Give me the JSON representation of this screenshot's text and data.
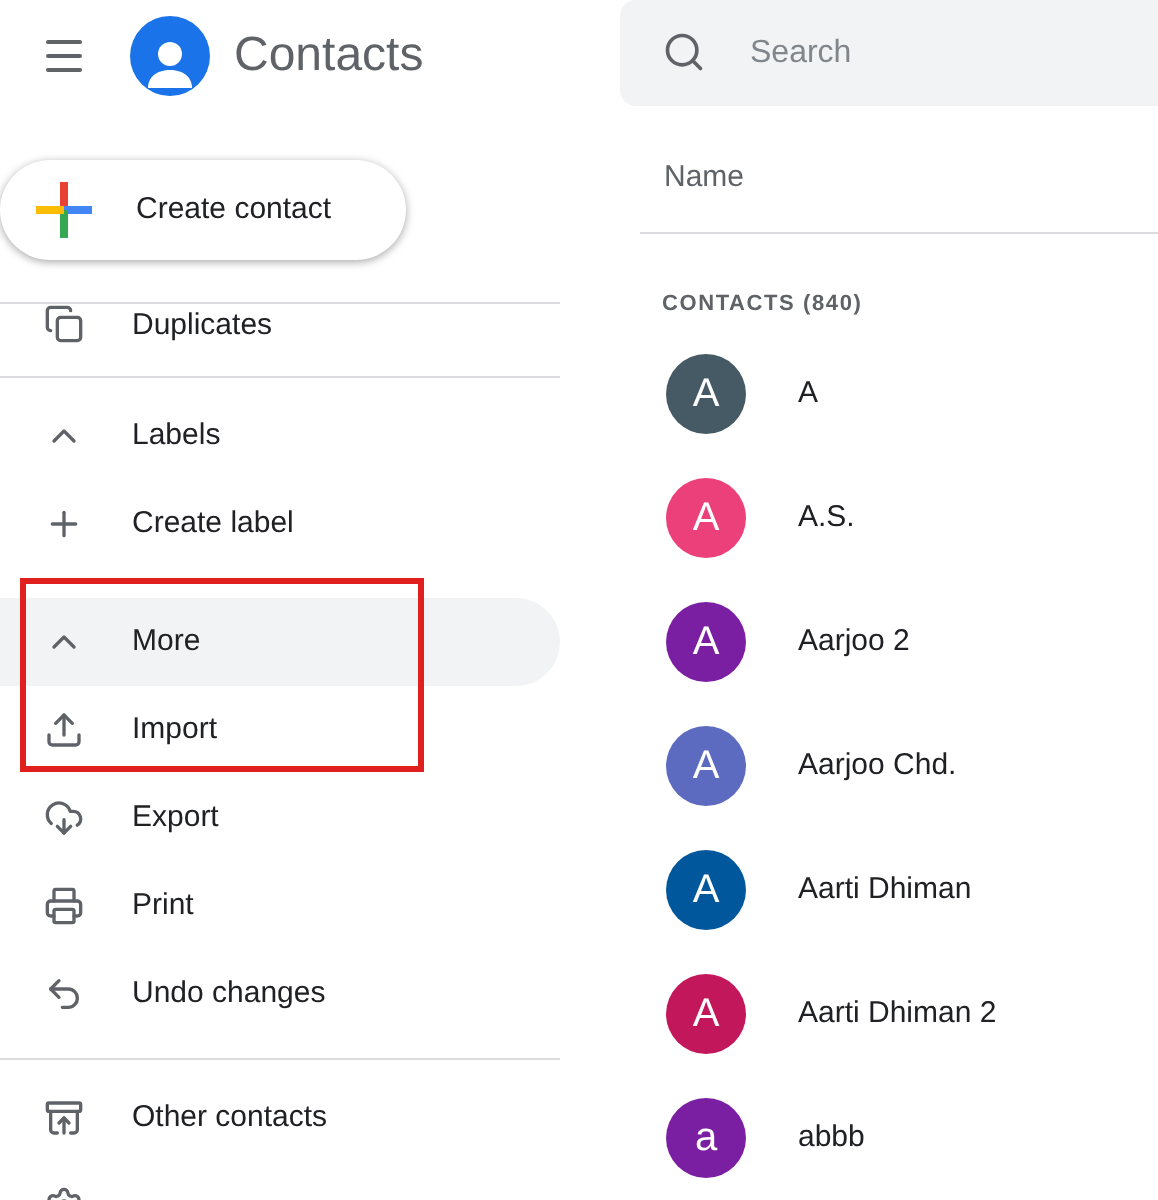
{
  "app": {
    "title": "Contacts"
  },
  "create_button": {
    "label": "Create contact"
  },
  "sidebar": {
    "items": [
      {
        "kind": "item",
        "label": "Duplicates",
        "selected": false
      },
      {
        "kind": "divider"
      },
      {
        "kind": "item",
        "label": "Labels",
        "selected": false
      },
      {
        "kind": "item",
        "label": "Create label",
        "selected": false
      },
      {
        "kind": "gap"
      },
      {
        "kind": "item",
        "label": "More",
        "selected": true
      },
      {
        "kind": "item",
        "label": "Import",
        "selected": false
      },
      {
        "kind": "item",
        "label": "Export",
        "selected": false
      },
      {
        "kind": "item",
        "label": "Print",
        "selected": false
      },
      {
        "kind": "item",
        "label": "Undo changes",
        "selected": false
      },
      {
        "kind": "divider"
      },
      {
        "kind": "item",
        "label": "Other contacts",
        "selected": false
      },
      {
        "kind": "cut",
        "selected": false
      }
    ]
  },
  "highlight": {
    "color": "#e0201f"
  },
  "search": {
    "placeholder": "Search"
  },
  "table": {
    "columns": [
      "Name"
    ]
  },
  "contacts": {
    "heading": "CONTACTS (840)",
    "rows": [
      {
        "initial": "A",
        "name": "A",
        "color": "#455a64"
      },
      {
        "initial": "A",
        "name": "A.S.",
        "color": "#ec407a"
      },
      {
        "initial": "A",
        "name": "Aarjoo 2",
        "color": "#7b1fa2"
      },
      {
        "initial": "A",
        "name": "Aarjoo Chd.",
        "color": "#5c6bc0"
      },
      {
        "initial": "A",
        "name": "Aarti Dhiman",
        "color": "#01579b"
      },
      {
        "initial": "A",
        "name": "Aarti Dhiman 2",
        "color": "#c2185b"
      },
      {
        "initial": "a",
        "name": "abbb",
        "color": "#7b1fa2"
      }
    ]
  }
}
